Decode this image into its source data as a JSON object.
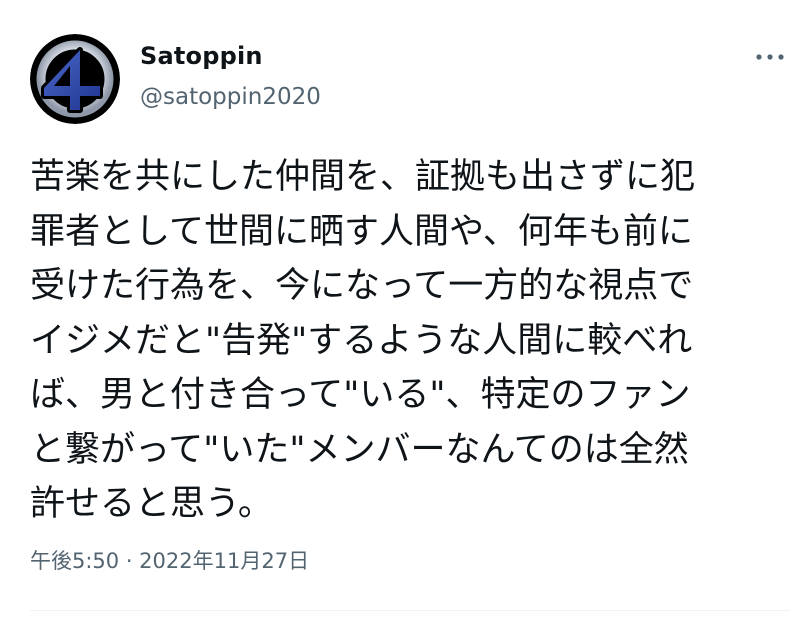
{
  "tweet": {
    "author": {
      "display_name": "Satoppin",
      "handle": "@satoppin2020",
      "avatar_icon": "fantastic-four-logo-icon"
    },
    "more_icon": "more-options-icon",
    "text_lines": [
      "苦楽を共にした仲間を、証拠も出さずに犯",
      "罪者として世間に晒す人間や、何年も前に",
      "受けた行為を、今になって一方的な視点で",
      "イジメだと\"告発\"するような人間に較べれ",
      "ば、男と付き合って\"いる\"、特定のファン",
      "と繋がって\"いた\"メンバーなんてのは全然",
      "許せると思う。"
    ],
    "timestamp": "午後5:50 · 2022年11月27日"
  },
  "colors": {
    "text_primary": "#0f1419",
    "text_secondary": "#536471",
    "divider": "#eff3f4"
  }
}
